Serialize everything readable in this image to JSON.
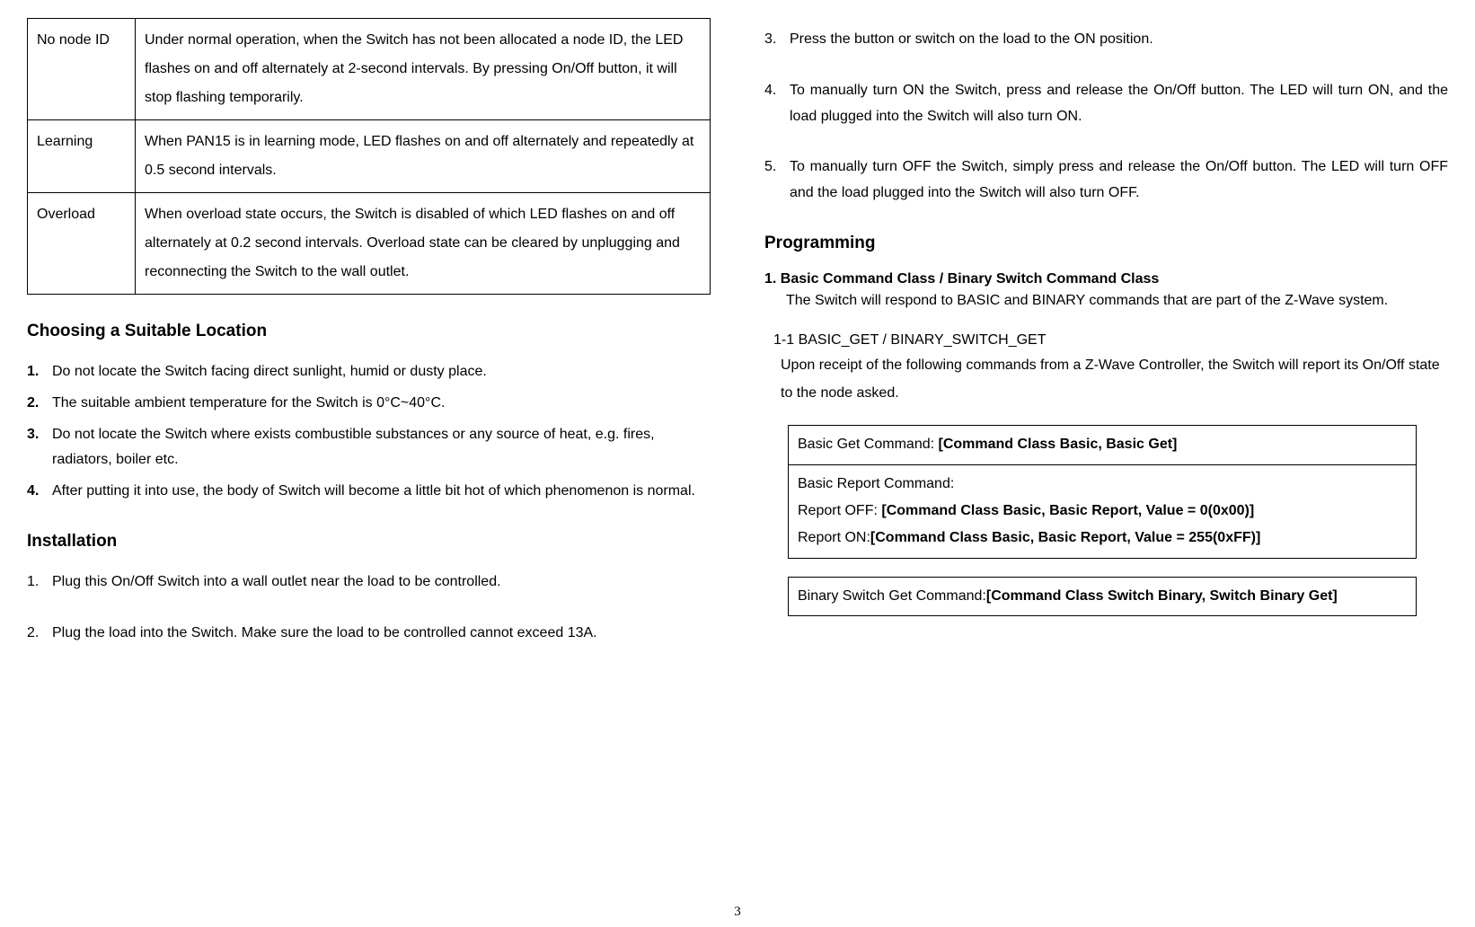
{
  "ledTable": {
    "rows": [
      {
        "label": "No node ID",
        "desc": "Under normal operation, when the Switch has not been allocated a node ID, the LED flashes on and off alternately at 2-second intervals. By pressing On/Off button, it will stop flashing temporarily."
      },
      {
        "label": "Learning",
        "desc": "When PAN15 is in learning mode, LED flashes on and off alternately and repeatedly at 0.5 second intervals."
      },
      {
        "label": "Overload",
        "desc": "When overload state occurs, the Switch is disabled of which LED flashes on and off alternately at 0.2 second intervals. Overload state can be cleared by unplugging and reconnecting the Switch to the wall outlet."
      }
    ]
  },
  "location": {
    "heading": "Choosing a Suitable Location",
    "items": [
      "Do not locate the Switch facing direct sunlight, humid or dusty place.",
      "The suitable ambient temperature for the Switch is 0°C~40°C.",
      "Do not locate the Switch where exists combustible substances or any source of heat, e.g. fires, radiators, boiler etc.",
      "After putting it into use, the body of Switch will become a little bit hot of which phenomenon is normal."
    ]
  },
  "installation": {
    "heading": "Installation",
    "items": [
      "Plug this On/Off Switch into a wall outlet near the load to be controlled.",
      "Plug the load into the Switch. Make sure the load to be controlled cannot exceed 13A."
    ]
  },
  "rightSteps": {
    "items": [
      {
        "num": "3.",
        "text": "Press the button or switch on the load to the ON position."
      },
      {
        "num": "4.",
        "text": "To manually turn ON the Switch, press and release the On/Off button. The LED will turn ON, and the load plugged into the Switch will also turn ON."
      },
      {
        "num": "5.",
        "text": "To manually turn OFF the Switch, simply press and release the On/Off button. The LED will turn OFF and the load plugged into the Switch will also turn OFF."
      }
    ]
  },
  "programming": {
    "heading": "Programming",
    "item1": {
      "num": "1.",
      "title": "Basic Command Class / Binary Switch Command Class",
      "desc": "The Switch will respond to BASIC and BINARY commands that are part of the Z-Wave system."
    },
    "sub11": {
      "title": "1-1 BASIC_GET / BINARY_SWITCH_GET",
      "desc": "Upon receipt of the following commands from a Z-Wave Controller, the Switch will report its On/Off state to the node asked."
    },
    "basicTable": {
      "row1_prefix": "Basic Get Command: ",
      "row1_bold": "[Command Class Basic, Basic Get]",
      "row2_line1": "Basic Report Command:",
      "row2_line2_prefix": "Report OFF: ",
      "row2_line2_bold": "[Command Class Basic, Basic Report, Value = 0(0x00)]",
      "row2_line3_prefix": "Report ON:",
      "row2_line3_bold": "[Command Class Basic, Basic Report, Value = 255(0xFF)]"
    },
    "binaryTable": {
      "row1_prefix": "Binary Switch Get Command:",
      "row1_bold": "[Command Class Switch Binary, Switch Binary Get]"
    }
  },
  "pageNumber": "3"
}
